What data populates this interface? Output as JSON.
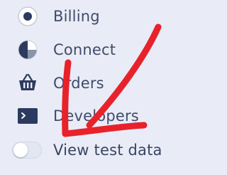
{
  "sidebar": {
    "items": [
      {
        "label": "Billing",
        "icon": "billing-icon"
      },
      {
        "label": "Connect",
        "icon": "connect-icon"
      },
      {
        "label": "Orders",
        "icon": "orders-basket-icon"
      },
      {
        "label": "Developers",
        "icon": "developers-terminal-icon"
      }
    ],
    "test_data_toggle": {
      "label": "View test data",
      "state": "off"
    }
  },
  "colors": {
    "background": "#e9ecf6",
    "text": "#404b6b",
    "icon": "#2d3a5f",
    "annotation_arrow": "#e8222a"
  }
}
